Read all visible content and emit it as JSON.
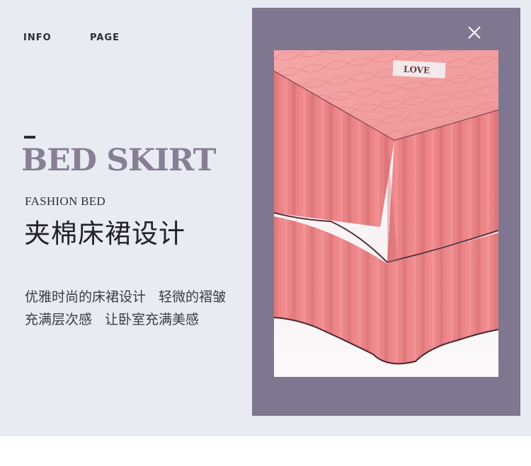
{
  "nav": {
    "info": "INFO",
    "page": "PAGE"
  },
  "headline": "BED SKIRT",
  "subtitle_en": "FASHION BED",
  "subtitle_cn": "夹棉床裙设计",
  "description": {
    "line1_a": "优雅时尚的床裙设计",
    "line1_b": "轻微的褶皱",
    "line2_a": "充满层次感",
    "line2_b": "让卧室充满美感"
  },
  "photo": {
    "badge_text": "LOVE"
  },
  "icons": {
    "close": "close-icon"
  },
  "colors": {
    "page_bg": "#e9ebf3",
    "frame": "#7f7690",
    "headline": "#877f94",
    "skirt": "#ee8c8e"
  }
}
